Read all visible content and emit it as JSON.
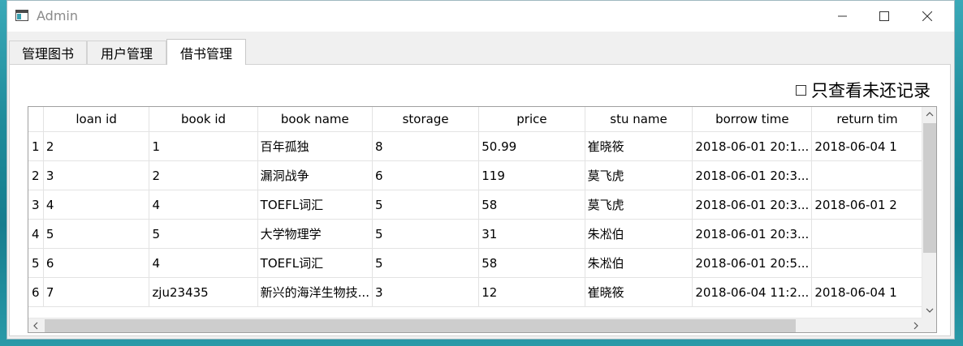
{
  "window": {
    "title": "Admin"
  },
  "tabs": [
    {
      "label": "管理图书",
      "active": false
    },
    {
      "label": "用户管理",
      "active": false
    },
    {
      "label": "借书管理",
      "active": true
    }
  ],
  "filter": {
    "label": "只查看未还记录",
    "checked": false
  },
  "table": {
    "columns": [
      "loan id",
      "book id",
      "book name",
      "storage",
      "price",
      "stu name",
      "borrow time",
      "return tim"
    ],
    "rows": [
      {
        "num": "1",
        "cells": [
          "2",
          "1",
          "百年孤独",
          "8",
          "50.99",
          "崔晓筱",
          "2018-06-01 20:1...",
          "2018-06-04 1"
        ]
      },
      {
        "num": "2",
        "cells": [
          "3",
          "2",
          "漏洞战争",
          "6",
          "119",
          "莫飞虎",
          "2018-06-01 20:3...",
          ""
        ]
      },
      {
        "num": "3",
        "cells": [
          "4",
          "4",
          "TOEFL词汇",
          "5",
          "58",
          "莫飞虎",
          "2018-06-01 20:3...",
          "2018-06-01 2"
        ]
      },
      {
        "num": "4",
        "cells": [
          "5",
          "5",
          "大学物理学",
          "5",
          "31",
          "朱凇伯",
          "2018-06-01 20:3...",
          ""
        ]
      },
      {
        "num": "5",
        "cells": [
          "6",
          "4",
          "TOEFL词汇",
          "5",
          "58",
          "朱凇伯",
          "2018-06-01 20:5...",
          ""
        ]
      },
      {
        "num": "6",
        "cells": [
          "7",
          "zju23435",
          "新兴的海洋生物技...",
          "3",
          "12",
          "崔晓筱",
          "2018-06-04 11:2...",
          "2018-06-04 1"
        ]
      }
    ]
  },
  "colors": {
    "background": "#1f8c9b",
    "window": "#f0f0f0",
    "scroll_thumb": "#cdcdcd"
  },
  "icons": {
    "app": "window-app-icon",
    "minimize": "minimize-icon",
    "maximize": "maximize-icon",
    "close": "close-icon",
    "scroll_up": "chevron-up-icon",
    "scroll_down": "chevron-down-icon",
    "scroll_left": "chevron-left-icon",
    "scroll_right": "chevron-right-icon"
  }
}
